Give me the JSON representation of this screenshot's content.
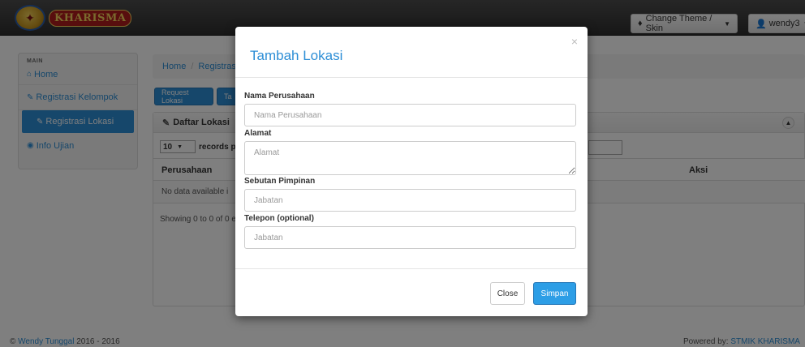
{
  "navbar": {
    "brand_text": "KHARISMA",
    "theme_button": "Change Theme / Skin",
    "user_button": "wendy3"
  },
  "sidebar": {
    "heading": "MAIN",
    "items": [
      {
        "label": "Home",
        "icon": "home-icon"
      },
      {
        "label": "Registrasi Kelompok",
        "icon": "edit-icon"
      },
      {
        "label": "Registrasi Lokasi",
        "icon": "edit-icon",
        "active": true
      },
      {
        "label": "Info Ujian",
        "icon": "eye-icon"
      }
    ]
  },
  "breadcrumb": {
    "home": "Home",
    "current": "Registras"
  },
  "actions": {
    "request_label": "Request Lokasi",
    "second_label": "Ta"
  },
  "panel": {
    "title": "Daftar Lokasi",
    "length_value": "10",
    "length_suffix": "records pe",
    "columns": {
      "perusahaan": "Perusahaan",
      "aksi": "Aksi"
    },
    "empty_text": "No data available i",
    "info_text": "Showing 0 to 0 of 0 e"
  },
  "footer": {
    "copyright_prefix": "©",
    "author": "Wendy Tunggal",
    "years": "2016 - 2016",
    "powered_prefix": "Powered by:",
    "powered_link": "STMIK KHARISMA"
  },
  "modal": {
    "title": "Tambah Lokasi",
    "close_icon": "×",
    "fields": {
      "nama": {
        "label": "Nama Perusahaan",
        "placeholder": "Nama Perusahaan"
      },
      "alamat": {
        "label": "Alamat",
        "placeholder": "Alamat"
      },
      "pimpinan": {
        "label": "Sebutan Pimpinan",
        "placeholder": "Jabatan"
      },
      "telepon": {
        "label": "Telepon (optional)",
        "placeholder": "Jabatan"
      }
    },
    "close_button": "Close",
    "save_button": "Simpan"
  },
  "colors": {
    "accent": "#2d8ed6",
    "navbar": "#3a3a3a",
    "overlay": "rgba(0,0,0,0.5)"
  }
}
